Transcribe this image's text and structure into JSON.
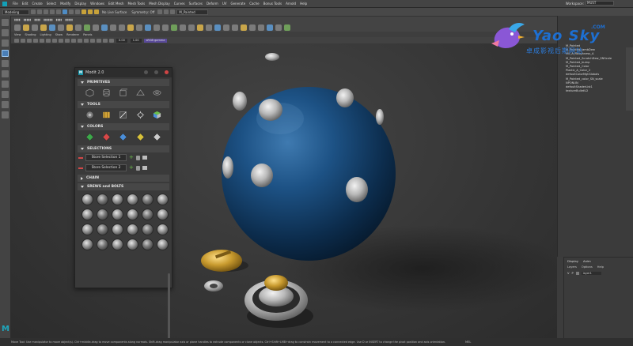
{
  "menubar": {
    "items": [
      "File",
      "Edit",
      "Create",
      "Select",
      "Modify",
      "Display",
      "Windows",
      "Edit Mesh",
      "Mesh Tools",
      "Mesh Display",
      "Curves",
      "Surfaces",
      "Deform",
      "UV",
      "Generate",
      "Cache",
      "Bonus Tools",
      "Arnold",
      "Help"
    ],
    "workspace_label": "Workspace:",
    "workspace_value": "MUST"
  },
  "statusline": {
    "mode": "Modeling",
    "live_surface": "No Live Surface",
    "symmetry": "Symmetry: Off",
    "pinned_object": "M_Painted"
  },
  "viewport": {
    "menus": [
      "View",
      "Shading",
      "Lighting",
      "Show",
      "Renderer",
      "Panels"
    ],
    "field_a": "0.00",
    "field_b": "1.00",
    "colorspace": "sRGB gamma"
  },
  "modit": {
    "title": "Modit 2.0",
    "sections": {
      "primitives": "PRIMITIVES",
      "tools": "TOOLS",
      "colors": "COLORS",
      "selections": "SELECTIONS",
      "chain": "CHAIN",
      "screws": "SREWS and BOLTS"
    },
    "store_1": "Store Selection 1",
    "store_2": "Store Selection 2",
    "swatches": [
      "#3da84a",
      "#d84848",
      "#4b8ed8",
      "#d8c23b",
      "#cccccc"
    ]
  },
  "outliner": {
    "items": [
      "M_Painted",
      "M_Painted_lambDew",
      "Mlt_A_Roughness_A",
      "M_Painted_ScratchDew_SNScale",
      "M_Painted_bump",
      "M_Painted_Color",
      "Plastic_A_Color_2",
      "defaultColorMgtGlobals",
      "M_Painted_color_SN_scale",
      "NPONUN",
      "defaultShaderList1",
      "textureBulletU2"
    ]
  },
  "layers": {
    "tabs": [
      "Display",
      "Anim"
    ],
    "options": [
      "Layers",
      "Options",
      "Help"
    ],
    "layer_flags": [
      "V",
      "P"
    ],
    "layer_name": "layer1"
  },
  "logo": {
    "brand": "Yao Sky",
    "com": ".COM",
    "tagline": "卓成影视后期网站"
  },
  "helpline": {
    "text": "Move Tool: Use manipulator to move object(s). Ctrl+middle-drag to move components along normals. Shift-drag manipulator axis or plane handles to extrude components or clone objects. Ctrl+Shift+LMB+drag to constrain movement to a connected edge. Use D or INSERT to change the pivot position and axis orientation.",
    "mel": "MEL"
  },
  "colors": {
    "maya_teal": "#1ea6bd",
    "sphere_blue": "#1c4f7d",
    "gold": "#c89a2e",
    "close_red": "#d04545"
  }
}
